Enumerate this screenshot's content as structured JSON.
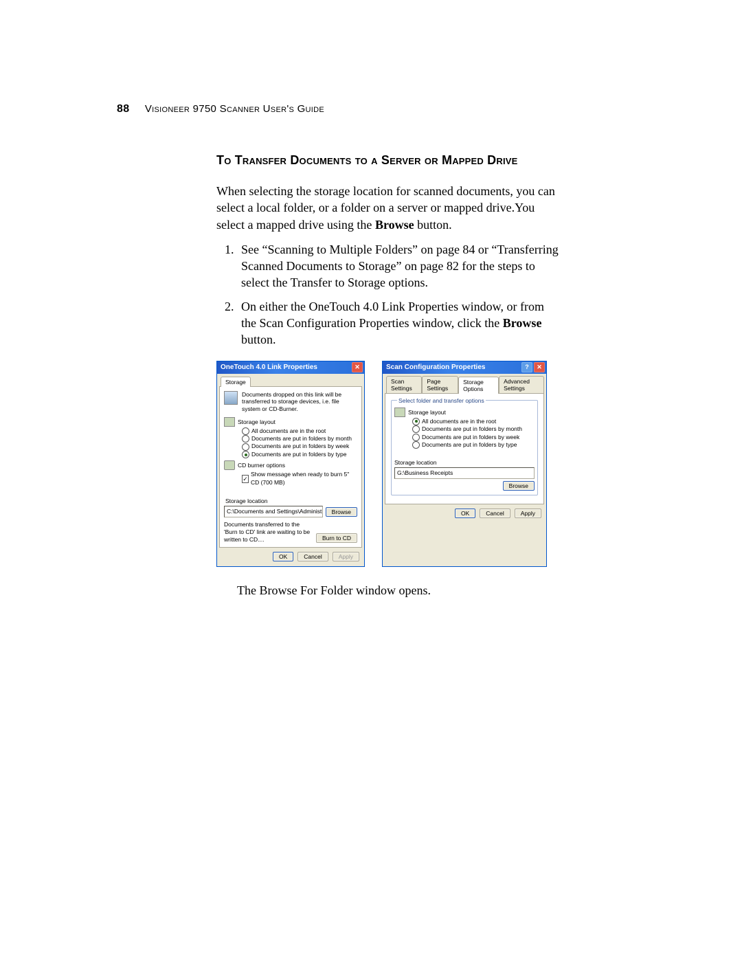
{
  "page": {
    "number": "88",
    "header": "Visioneer 9750 Scanner User's Guide"
  },
  "section": {
    "title": "To Transfer Documents to a Server or Mapped Drive",
    "intro_1": "When selecting the storage location for scanned documents, you can select a local folder, or a folder on a server or mapped drive.You select a mapped drive using the ",
    "intro_bold": "Browse",
    "intro_2": " button.",
    "step1": "See “Scanning to Multiple Folders” on page 84 or “Transferring Scanned Documents to Storage” on page 82 for the steps to select the Transfer to Storage options.",
    "step2_a": "On either the OneTouch 4.0 Link Properties window, or from the Scan Configuration Properties window, click the ",
    "step2_bold": "Browse",
    "step2_b": " button.",
    "after": "The Browse For Folder window opens."
  },
  "dlg1": {
    "title": "OneTouch 4.0 Link Properties",
    "tab": "Storage",
    "desc": "Documents dropped on this link will be transferred to storage devices, i.e. file system or CD-Burner.",
    "layout_hdr": "Storage layout",
    "opts": [
      "All documents are in the root",
      "Documents are put in folders by month",
      "Documents are put in folders by week",
      "Documents are put in folders by type"
    ],
    "selected_opt": 3,
    "cd_hdr": "CD burner options",
    "cd_opt": "Show message when ready to burn 5\" CD (700 MB)",
    "loc_lbl": "Storage location",
    "loc_val": "C:\\Documents and Settings\\Administrator\\My Do",
    "browse": "Browse",
    "note": "Documents transferred to the 'Burn to CD' link are waiting to be written to CD....",
    "burn": "Burn to CD",
    "ok": "OK",
    "cancel": "Cancel",
    "apply": "Apply"
  },
  "dlg2": {
    "title": "Scan Configuration Properties",
    "tabs": [
      "Scan Settings",
      "Page Settings",
      "Storage Options",
      "Advanced Settings"
    ],
    "active_tab": 2,
    "fs_legend": "Select folder and transfer options",
    "layout_hdr": "Storage layout",
    "opts": [
      "All documents are in the root",
      "Documents are put in folders by month",
      "Documents are put in folders by week",
      "Documents are put in folders by type"
    ],
    "selected_opt": 0,
    "loc_lbl": "Storage location",
    "loc_val": "G:\\Business Receipts",
    "browse": "Browse",
    "ok": "OK",
    "cancel": "Cancel",
    "apply": "Apply"
  }
}
